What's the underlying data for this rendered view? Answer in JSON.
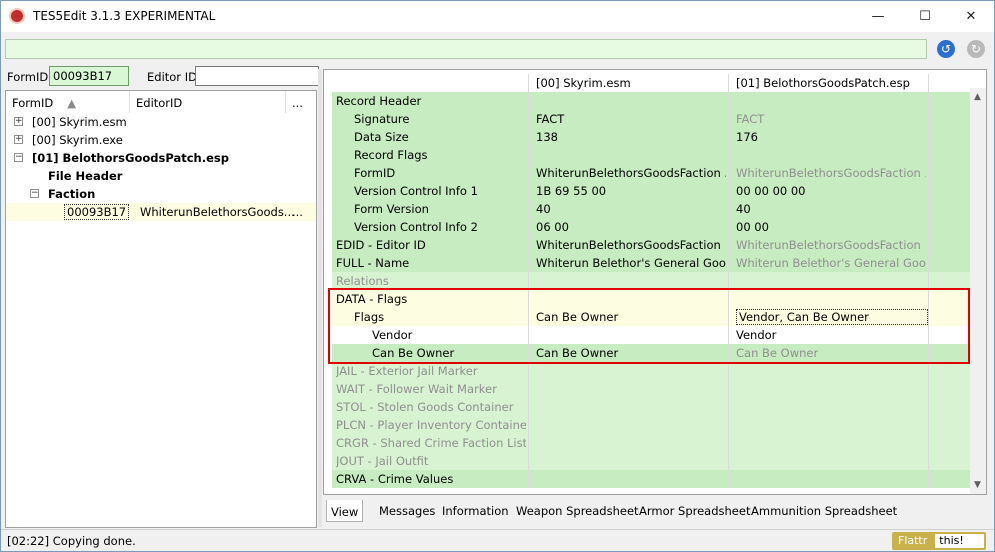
{
  "window": {
    "title": "TES5Edit 3.1.3 EXPERIMENTAL",
    "min": "—",
    "max": "☐",
    "close": "✕"
  },
  "search": {
    "formid_label": "FormID",
    "formid_value": "00093B17",
    "editorid_label": "Editor ID"
  },
  "left": {
    "headers": [
      "FormID",
      "EditorID",
      "..."
    ],
    "rows": [
      {
        "indent": 0,
        "exp": "+",
        "text": "[00] Skyrim.esm",
        "bold": false
      },
      {
        "indent": 0,
        "exp": "+",
        "text": "[00] Skyrim.exe",
        "bold": false
      },
      {
        "indent": 0,
        "exp": "−",
        "text": "[01] BelothorsGoodsPatch.esp",
        "bold": true
      },
      {
        "indent": 1,
        "exp": "",
        "text": "File Header",
        "bold": true
      },
      {
        "indent": 1,
        "exp": "−",
        "text": "Faction",
        "bold": true
      },
      {
        "indent": 2,
        "exp": "",
        "text": "00093B17",
        "bold": false,
        "editorid": "WhiterunBelethorsGoods...",
        "dots": "...",
        "selected": true
      }
    ]
  },
  "right": {
    "headers": [
      "",
      "[00] Skyrim.esm",
      "[01] BelothorsGoodsPatch.esp"
    ],
    "rows": [
      {
        "c0": "Record Header",
        "c1": "",
        "c2": "",
        "ind": 0,
        "bg": "green",
        "g2": false
      },
      {
        "c0": "Signature",
        "c1": "FACT",
        "c2": "FACT",
        "ind": 1,
        "bg": "green",
        "g2": true
      },
      {
        "c0": "Data Size",
        "c1": "138",
        "c2": "176",
        "ind": 1,
        "bg": "green",
        "g2": false
      },
      {
        "c0": "Record Flags",
        "c1": "",
        "c2": "",
        "ind": 1,
        "bg": "green",
        "g2": false
      },
      {
        "c0": "FormID",
        "c1": "WhiterunBelethorsGoodsFaction ...",
        "c2": "WhiterunBelethorsGoodsFaction ...",
        "ind": 1,
        "bg": "green",
        "g2": true
      },
      {
        "c0": "Version Control Info 1",
        "c1": "1B 69 55 00",
        "c2": "00 00 00 00",
        "ind": 1,
        "bg": "green",
        "g2": false
      },
      {
        "c0": "Form Version",
        "c1": "40",
        "c2": "40",
        "ind": 1,
        "bg": "green",
        "g2": false
      },
      {
        "c0": "Version Control Info 2",
        "c1": "06 00",
        "c2": "00 00",
        "ind": 1,
        "bg": "green",
        "g2": false
      },
      {
        "c0": "EDID - Editor ID",
        "c1": "WhiterunBelethorsGoodsFaction",
        "c2": "WhiterunBelethorsGoodsFaction",
        "ind": 0,
        "bg": "green",
        "g2": true
      },
      {
        "c0": "FULL - Name",
        "c1": "Whiterun Belethor's General Goo...",
        "c2": "Whiterun Belethor's General Goo...",
        "ind": 0,
        "bg": "green",
        "g2": true
      },
      {
        "c0": "Relations",
        "c1": "",
        "c2": "",
        "ind": 0,
        "bg": "lgreen",
        "g0": true
      },
      {
        "c0": "DATA - Flags",
        "c1": "",
        "c2": "",
        "ind": 0,
        "bg": "yellow",
        "g2": false
      },
      {
        "c0": "Flags",
        "c1": "Can Be Owner",
        "c2": "Vendor, Can Be Owner",
        "ind": 1,
        "bg": "yellow",
        "g2": false,
        "sel": true
      },
      {
        "c0": "Vendor",
        "c1": "",
        "c2": "Vendor",
        "ind": 2,
        "bg": "white",
        "g2": false
      },
      {
        "c0": "Can Be Owner",
        "c1": "Can Be Owner",
        "c2": "Can Be Owner",
        "ind": 2,
        "bg": "green",
        "g2": true
      },
      {
        "c0": "JAIL - Exterior Jail Marker",
        "c1": "",
        "c2": "",
        "ind": 0,
        "bg": "lgreen",
        "g0": true
      },
      {
        "c0": "WAIT - Follower Wait Marker",
        "c1": "",
        "c2": "",
        "ind": 0,
        "bg": "lgreen",
        "g0": true
      },
      {
        "c0": "STOL - Stolen Goods Container",
        "c1": "",
        "c2": "",
        "ind": 0,
        "bg": "lgreen",
        "g0": true
      },
      {
        "c0": "PLCN - Player Inventory Container",
        "c1": "",
        "c2": "",
        "ind": 0,
        "bg": "lgreen",
        "g0": true
      },
      {
        "c0": "CRGR - Shared Crime Faction List",
        "c1": "",
        "c2": "",
        "ind": 0,
        "bg": "lgreen",
        "g0": true
      },
      {
        "c0": "JOUT - Jail Outfit",
        "c1": "",
        "c2": "",
        "ind": 0,
        "bg": "lgreen",
        "g0": true
      },
      {
        "c0": "CRVA - Crime Values",
        "c1": "",
        "c2": "",
        "ind": 0,
        "bg": "green",
        "g2": false
      }
    ]
  },
  "tabs": [
    "View",
    "Messages",
    "Information",
    "Weapon Spreadsheet",
    "Armor Spreadsheet",
    "Ammunition Spreadsheet"
  ],
  "status": {
    "text": "[02:22] Copying done.",
    "flattr": "Flattr",
    "this": "this!"
  }
}
